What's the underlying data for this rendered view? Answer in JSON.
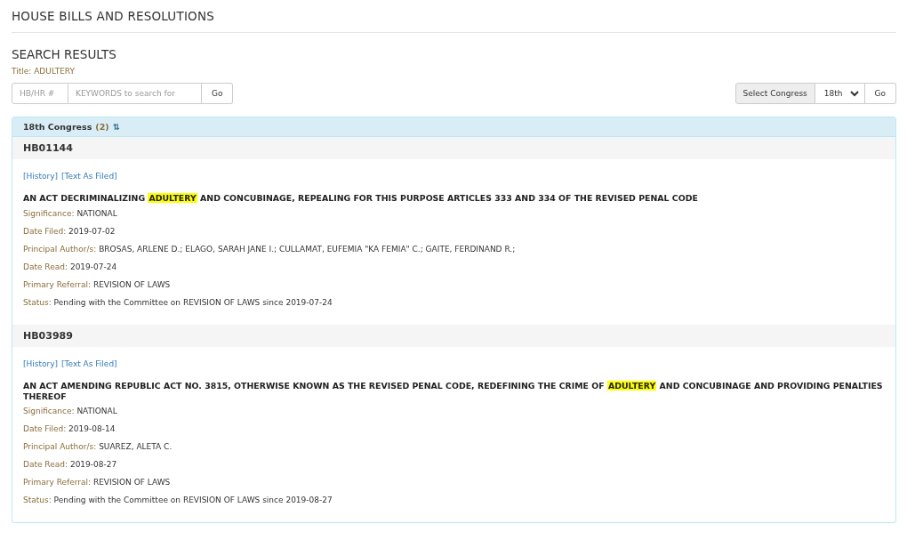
{
  "page_title": "HOUSE BILLS AND RESOLUTIONS",
  "section_title": "SEARCH RESULTS",
  "filter": {
    "label": "Title:",
    "value": "ADULTERY"
  },
  "search": {
    "number_placeholder": "HB/HR #",
    "keywords_placeholder": "KEYWORDS to search for",
    "go": "Go"
  },
  "congress_select": {
    "label": "Select Congress",
    "value": "18th",
    "go": "Go"
  },
  "group": {
    "title": "18th Congress",
    "count": "(2)",
    "sort_icon": "⇅"
  },
  "bills": [
    {
      "number": "HB01144",
      "links": [
        "[History]",
        "[Text As Filed]"
      ],
      "title": [
        {
          "text": "AN ACT DECRIMINALIZING ",
          "highlighted": false
        },
        {
          "text": "ADULTERY",
          "highlighted": true
        },
        {
          "text": " AND CONCUBINAGE, REPEALING FOR THIS PURPOSE ARTICLES 333 AND 334 OF THE REVISED PENAL CODE",
          "highlighted": false
        }
      ],
      "fields": [
        {
          "label": "Significance:",
          "value": "NATIONAL"
        },
        {
          "label": "Date Filed:",
          "value": "2019-07-02"
        },
        {
          "label": "Principal Author/s:",
          "value": "BROSAS, ARLENE D.; ELAGO, SARAH JANE I.; CULLAMAT, EUFEMIA \"KA FEMIA\" C.; GAITE, FERDINAND R.;"
        },
        {
          "label": "Date Read:",
          "value": "2019-07-24"
        },
        {
          "label": "Primary Referral:",
          "value": "REVISION OF LAWS"
        },
        {
          "label": "Status:",
          "value": "Pending with the Committee on REVISION OF LAWS since 2019-07-24"
        }
      ]
    },
    {
      "number": "HB03989",
      "links": [
        "[History]",
        "[Text As Filed]"
      ],
      "title": [
        {
          "text": "AN ACT AMENDING REPUBLIC ACT NO. 3815, OTHERWISE KNOWN AS THE REVISED PENAL CODE, REDEFINING THE CRIME OF ",
          "highlighted": false
        },
        {
          "text": "ADULTERY",
          "highlighted": true
        },
        {
          "text": " AND CONCUBINAGE AND PROVIDING PENALTIES THEREOF",
          "highlighted": false
        }
      ],
      "fields": [
        {
          "label": "Significance:",
          "value": "NATIONAL"
        },
        {
          "label": "Date Filed:",
          "value": "2019-08-14"
        },
        {
          "label": "Principal Author/s:",
          "value": "SUAREZ, ALETA C."
        },
        {
          "label": "Date Read:",
          "value": "2019-08-27"
        },
        {
          "label": "Primary Referral:",
          "value": "REVISION OF LAWS"
        },
        {
          "label": "Status:",
          "value": "Pending with the Committee on REVISION OF LAWS since 2019-08-27"
        }
      ]
    }
  ]
}
